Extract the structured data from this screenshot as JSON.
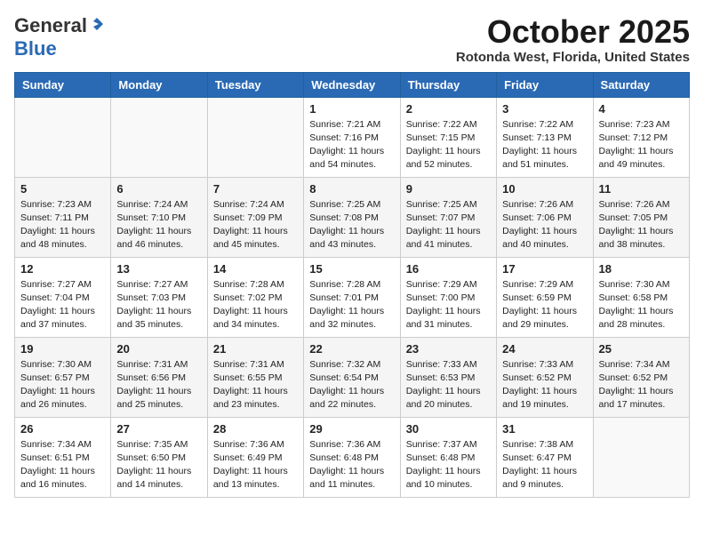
{
  "header": {
    "logo_general": "General",
    "logo_blue": "Blue",
    "month_title": "October 2025",
    "location": "Rotonda West, Florida, United States"
  },
  "weekdays": [
    "Sunday",
    "Monday",
    "Tuesday",
    "Wednesday",
    "Thursday",
    "Friday",
    "Saturday"
  ],
  "weeks": [
    [
      {
        "day": "",
        "sunrise": "",
        "sunset": "",
        "daylight": ""
      },
      {
        "day": "",
        "sunrise": "",
        "sunset": "",
        "daylight": ""
      },
      {
        "day": "",
        "sunrise": "",
        "sunset": "",
        "daylight": ""
      },
      {
        "day": "1",
        "sunrise": "Sunrise: 7:21 AM",
        "sunset": "Sunset: 7:16 PM",
        "daylight": "Daylight: 11 hours and 54 minutes."
      },
      {
        "day": "2",
        "sunrise": "Sunrise: 7:22 AM",
        "sunset": "Sunset: 7:15 PM",
        "daylight": "Daylight: 11 hours and 52 minutes."
      },
      {
        "day": "3",
        "sunrise": "Sunrise: 7:22 AM",
        "sunset": "Sunset: 7:13 PM",
        "daylight": "Daylight: 11 hours and 51 minutes."
      },
      {
        "day": "4",
        "sunrise": "Sunrise: 7:23 AM",
        "sunset": "Sunset: 7:12 PM",
        "daylight": "Daylight: 11 hours and 49 minutes."
      }
    ],
    [
      {
        "day": "5",
        "sunrise": "Sunrise: 7:23 AM",
        "sunset": "Sunset: 7:11 PM",
        "daylight": "Daylight: 11 hours and 48 minutes."
      },
      {
        "day": "6",
        "sunrise": "Sunrise: 7:24 AM",
        "sunset": "Sunset: 7:10 PM",
        "daylight": "Daylight: 11 hours and 46 minutes."
      },
      {
        "day": "7",
        "sunrise": "Sunrise: 7:24 AM",
        "sunset": "Sunset: 7:09 PM",
        "daylight": "Daylight: 11 hours and 45 minutes."
      },
      {
        "day": "8",
        "sunrise": "Sunrise: 7:25 AM",
        "sunset": "Sunset: 7:08 PM",
        "daylight": "Daylight: 11 hours and 43 minutes."
      },
      {
        "day": "9",
        "sunrise": "Sunrise: 7:25 AM",
        "sunset": "Sunset: 7:07 PM",
        "daylight": "Daylight: 11 hours and 41 minutes."
      },
      {
        "day": "10",
        "sunrise": "Sunrise: 7:26 AM",
        "sunset": "Sunset: 7:06 PM",
        "daylight": "Daylight: 11 hours and 40 minutes."
      },
      {
        "day": "11",
        "sunrise": "Sunrise: 7:26 AM",
        "sunset": "Sunset: 7:05 PM",
        "daylight": "Daylight: 11 hours and 38 minutes."
      }
    ],
    [
      {
        "day": "12",
        "sunrise": "Sunrise: 7:27 AM",
        "sunset": "Sunset: 7:04 PM",
        "daylight": "Daylight: 11 hours and 37 minutes."
      },
      {
        "day": "13",
        "sunrise": "Sunrise: 7:27 AM",
        "sunset": "Sunset: 7:03 PM",
        "daylight": "Daylight: 11 hours and 35 minutes."
      },
      {
        "day": "14",
        "sunrise": "Sunrise: 7:28 AM",
        "sunset": "Sunset: 7:02 PM",
        "daylight": "Daylight: 11 hours and 34 minutes."
      },
      {
        "day": "15",
        "sunrise": "Sunrise: 7:28 AM",
        "sunset": "Sunset: 7:01 PM",
        "daylight": "Daylight: 11 hours and 32 minutes."
      },
      {
        "day": "16",
        "sunrise": "Sunrise: 7:29 AM",
        "sunset": "Sunset: 7:00 PM",
        "daylight": "Daylight: 11 hours and 31 minutes."
      },
      {
        "day": "17",
        "sunrise": "Sunrise: 7:29 AM",
        "sunset": "Sunset: 6:59 PM",
        "daylight": "Daylight: 11 hours and 29 minutes."
      },
      {
        "day": "18",
        "sunrise": "Sunrise: 7:30 AM",
        "sunset": "Sunset: 6:58 PM",
        "daylight": "Daylight: 11 hours and 28 minutes."
      }
    ],
    [
      {
        "day": "19",
        "sunrise": "Sunrise: 7:30 AM",
        "sunset": "Sunset: 6:57 PM",
        "daylight": "Daylight: 11 hours and 26 minutes."
      },
      {
        "day": "20",
        "sunrise": "Sunrise: 7:31 AM",
        "sunset": "Sunset: 6:56 PM",
        "daylight": "Daylight: 11 hours and 25 minutes."
      },
      {
        "day": "21",
        "sunrise": "Sunrise: 7:31 AM",
        "sunset": "Sunset: 6:55 PM",
        "daylight": "Daylight: 11 hours and 23 minutes."
      },
      {
        "day": "22",
        "sunrise": "Sunrise: 7:32 AM",
        "sunset": "Sunset: 6:54 PM",
        "daylight": "Daylight: 11 hours and 22 minutes."
      },
      {
        "day": "23",
        "sunrise": "Sunrise: 7:33 AM",
        "sunset": "Sunset: 6:53 PM",
        "daylight": "Daylight: 11 hours and 20 minutes."
      },
      {
        "day": "24",
        "sunrise": "Sunrise: 7:33 AM",
        "sunset": "Sunset: 6:52 PM",
        "daylight": "Daylight: 11 hours and 19 minutes."
      },
      {
        "day": "25",
        "sunrise": "Sunrise: 7:34 AM",
        "sunset": "Sunset: 6:52 PM",
        "daylight": "Daylight: 11 hours and 17 minutes."
      }
    ],
    [
      {
        "day": "26",
        "sunrise": "Sunrise: 7:34 AM",
        "sunset": "Sunset: 6:51 PM",
        "daylight": "Daylight: 11 hours and 16 minutes."
      },
      {
        "day": "27",
        "sunrise": "Sunrise: 7:35 AM",
        "sunset": "Sunset: 6:50 PM",
        "daylight": "Daylight: 11 hours and 14 minutes."
      },
      {
        "day": "28",
        "sunrise": "Sunrise: 7:36 AM",
        "sunset": "Sunset: 6:49 PM",
        "daylight": "Daylight: 11 hours and 13 minutes."
      },
      {
        "day": "29",
        "sunrise": "Sunrise: 7:36 AM",
        "sunset": "Sunset: 6:48 PM",
        "daylight": "Daylight: 11 hours and 11 minutes."
      },
      {
        "day": "30",
        "sunrise": "Sunrise: 7:37 AM",
        "sunset": "Sunset: 6:48 PM",
        "daylight": "Daylight: 11 hours and 10 minutes."
      },
      {
        "day": "31",
        "sunrise": "Sunrise: 7:38 AM",
        "sunset": "Sunset: 6:47 PM",
        "daylight": "Daylight: 11 hours and 9 minutes."
      },
      {
        "day": "",
        "sunrise": "",
        "sunset": "",
        "daylight": ""
      }
    ]
  ]
}
